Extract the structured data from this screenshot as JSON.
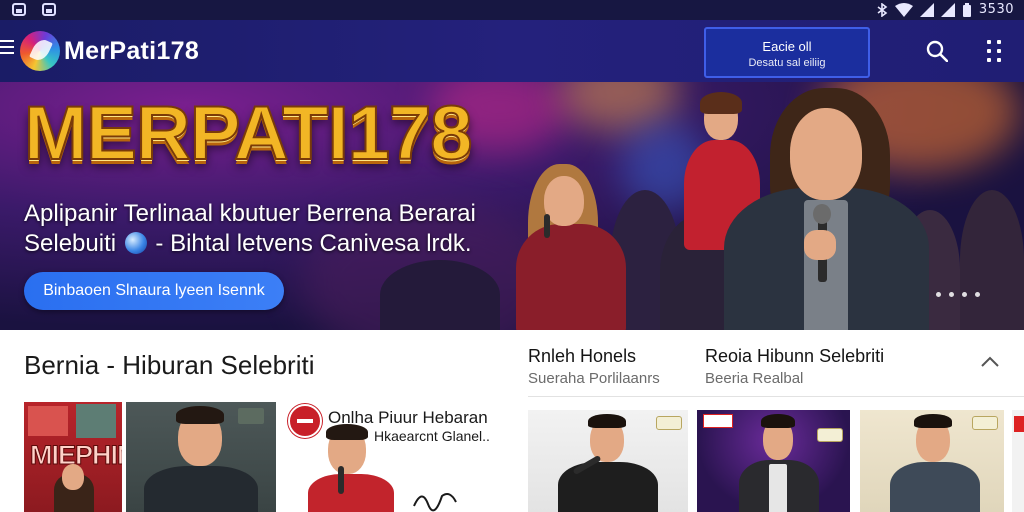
{
  "status_bar": {
    "time": "3530",
    "icons": [
      "image-icon",
      "notification-icon",
      "bluetooth-icon",
      "wifi-icon",
      "signal-icon",
      "signal-icon",
      "battery-icon"
    ]
  },
  "app_bar": {
    "brand": "MerPati178",
    "cta": {
      "line1": "Eacie oll",
      "line2": "Desatu sal eiliig"
    },
    "colors": {
      "bar": "#1f1d72",
      "cta_border": "#3f5ee8"
    }
  },
  "hero": {
    "title": "MERPATI178",
    "subtitle_line1": "Aplipanir Terlinaal kbutuer Berrena Berarai",
    "subtitle_line2_a": "Selebuiti",
    "subtitle_line2_b": "- Bihtal letvens Canivesa lrdk.",
    "button_label": "Binbaoen Slnaura lyeen Isennk",
    "carousel": {
      "count": 4,
      "active": 0
    },
    "colors": {
      "title": "#f2b625",
      "button": "#2a6ff0"
    }
  },
  "section": {
    "title": "Bernia - Hiburan Selebriti",
    "announcement": {
      "line1": "Onlha Piuur Hebaran",
      "line2": "Hkaearcnt Glanel.."
    },
    "poster_text": "MIEPHIN"
  },
  "right_column": {
    "col1": {
      "title": "Rnleh Honels",
      "subtitle": "Sueraha Porlilaanrs"
    },
    "col2": {
      "title": "Reoia Hibunn Selebriti",
      "subtitle": "Beeria Realbal"
    }
  }
}
